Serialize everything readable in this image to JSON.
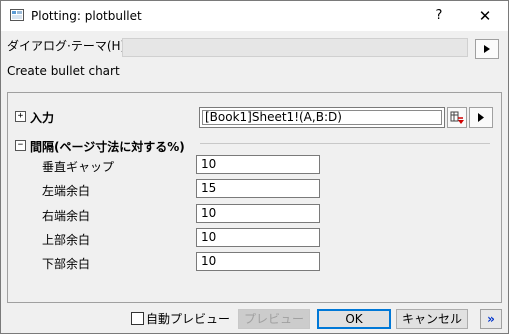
{
  "window": {
    "title": "Plotting: plotbullet",
    "help_label": "?",
    "close_label": "✕"
  },
  "theme": {
    "label": "ダイアログ·テーマ(H)",
    "value": ""
  },
  "description": "Create bullet chart",
  "input_section": {
    "expander": "+",
    "label": "入力",
    "value": "[Book1]Sheet1!(A,B:D)"
  },
  "spacing_section": {
    "expander": "−",
    "label": "間隔(ページ寸法に対する%)",
    "rows": [
      {
        "label": "垂直ギャップ",
        "value": "10"
      },
      {
        "label": "左端余白",
        "value": "15"
      },
      {
        "label": "右端余白",
        "value": "10"
      },
      {
        "label": "上部余白",
        "value": "10"
      },
      {
        "label": "下部余白",
        "value": "10"
      }
    ]
  },
  "footer": {
    "auto_preview_label": "自動プレビュー",
    "auto_preview_checked": false,
    "preview_label": "プレビュー",
    "ok_label": "OK",
    "cancel_label": "キャンセル",
    "more_label": "»"
  }
}
